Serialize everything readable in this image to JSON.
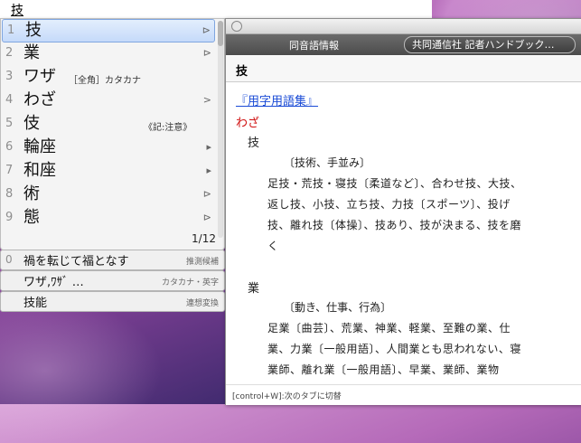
{
  "input": {
    "text": "技"
  },
  "candidates": [
    {
      "num": "1",
      "word": "技",
      "annotation": "",
      "arrow": "⊳"
    },
    {
      "num": "2",
      "word": "業",
      "annotation": "",
      "arrow": "⊳"
    },
    {
      "num": "3",
      "word": "ワザ",
      "annotation": "［全角］カタカナ",
      "arrow": ""
    },
    {
      "num": "4",
      "word": "わざ",
      "annotation": "",
      "arrow": ">"
    },
    {
      "num": "5",
      "word": "伎",
      "annotation": "《記:注意》",
      "arrow": ""
    },
    {
      "num": "6",
      "word": "輪座",
      "annotation": "",
      "arrow": "▸"
    },
    {
      "num": "7",
      "word": "和座",
      "annotation": "",
      "arrow": "▸"
    },
    {
      "num": "8",
      "word": "術",
      "annotation": "",
      "arrow": "⊳"
    },
    {
      "num": "9",
      "word": "態",
      "annotation": "",
      "arrow": "⊳"
    }
  ],
  "counter": "1/12",
  "suggestions": [
    {
      "num": "0",
      "word": "禍を転じて福となす",
      "tag": "推測候補"
    },
    {
      "num": "",
      "word": "ワザ,ﾜｻﾞ …",
      "tag": "カタカナ・英字"
    },
    {
      "num": "",
      "word": "技能",
      "tag": "連想変換"
    }
  ],
  "panel": {
    "tab1": "同音語情報",
    "tab2": "共同通信社 記者ハンドブック…",
    "heading": "技",
    "source": "『用字用語集』",
    "reading": "わざ",
    "entries": [
      {
        "kanji": "技",
        "meaning": "〔技術、手並み〕",
        "lines": [
          "足技・荒技・寝技〔柔道など〕、合わせ技、大技、",
          "返し技、小技、立ち技、力技〔スポーツ〕、投げ",
          "技、離れ技〔体操〕、技あり、技が決まる、技を磨",
          "く"
        ]
      },
      {
        "kanji": "業",
        "meaning": "〔動き、仕事、行為〕",
        "lines": [
          "足業〔曲芸〕、荒業、神業、軽業、至難の業、仕",
          "業、力業〔一般用語〕、人間業とも思われない、寝",
          "業師、離れ業〔一般用語〕、早業、業師、業物"
        ]
      }
    ],
    "footer": "[control+W]:次のタブに切替"
  }
}
